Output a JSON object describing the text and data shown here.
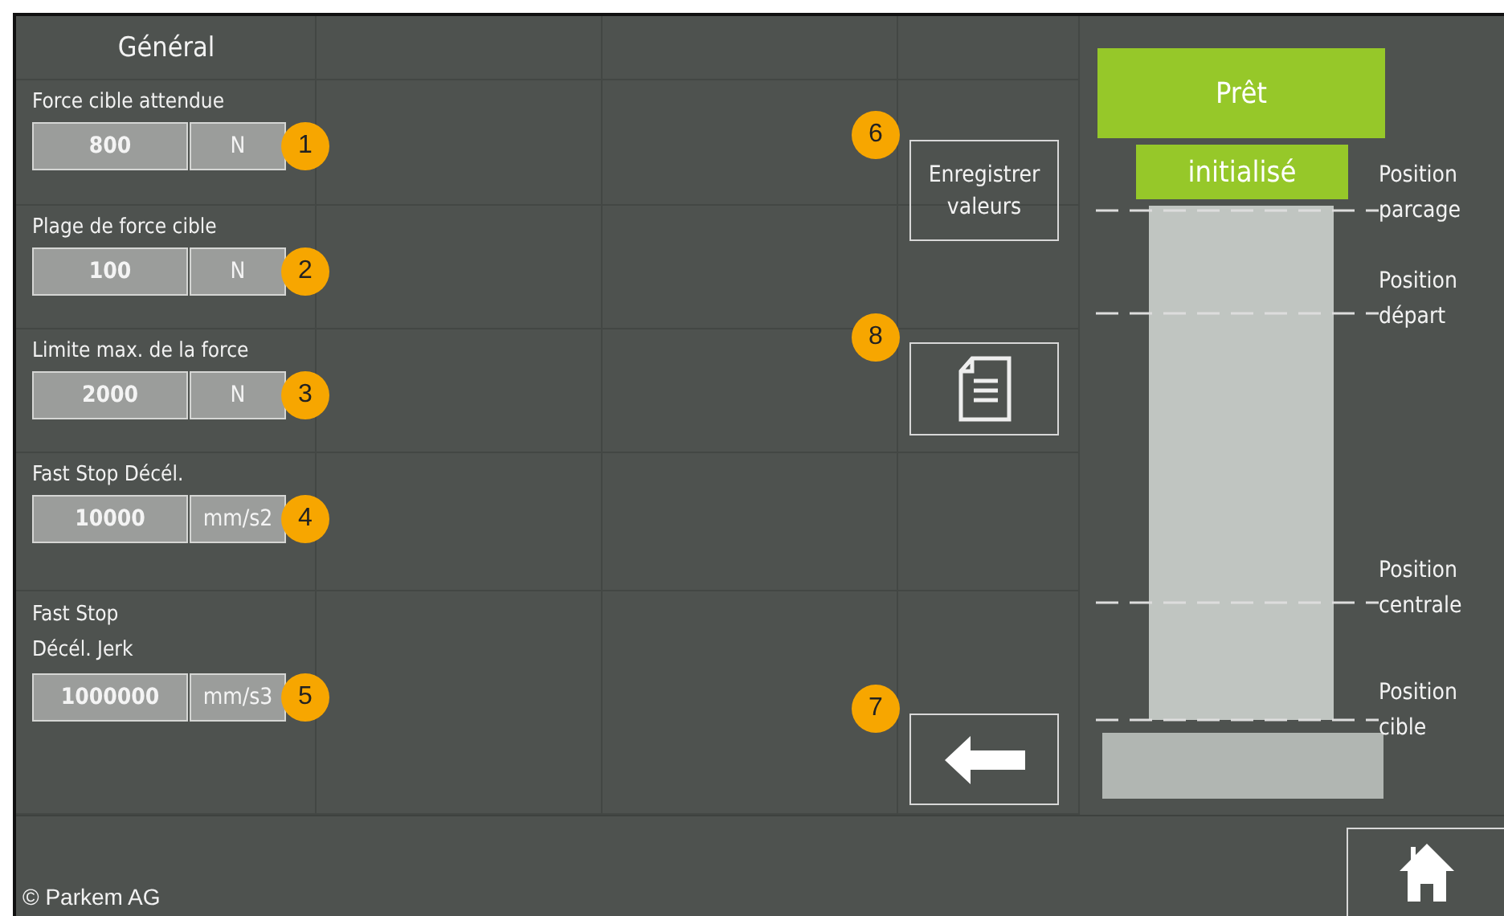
{
  "section_title": "Général",
  "fields": [
    {
      "label": "Force cible attendue",
      "value": "800",
      "unit": "N",
      "badge": "1"
    },
    {
      "label": "Plage de force cible",
      "value": "100",
      "unit": "N",
      "badge": "2"
    },
    {
      "label": "Limite max. de la force",
      "value": "2000",
      "unit": "N",
      "badge": "3"
    },
    {
      "label": "Fast Stop Décél.",
      "value": "10000",
      "unit": "mm/s2",
      "badge": "4"
    },
    {
      "label": "Fast Stop Décél. Jerk",
      "value": "1000000",
      "unit": "mm/s3",
      "badge": "5"
    }
  ],
  "buttons": [
    {
      "kind": "save",
      "label": "Enregistrer valeurs",
      "badge": "6"
    },
    {
      "kind": "document",
      "badge": "8"
    },
    {
      "kind": "back",
      "badge": "7"
    }
  ],
  "status": [
    {
      "label": "Prêt"
    },
    {
      "label": "initialisé"
    }
  ],
  "positions": [
    {
      "label": "Position parcage"
    },
    {
      "label": "Position départ"
    },
    {
      "label": "Position centrale"
    },
    {
      "label": "Position cible"
    }
  ],
  "footer": "© Parkem AG"
}
